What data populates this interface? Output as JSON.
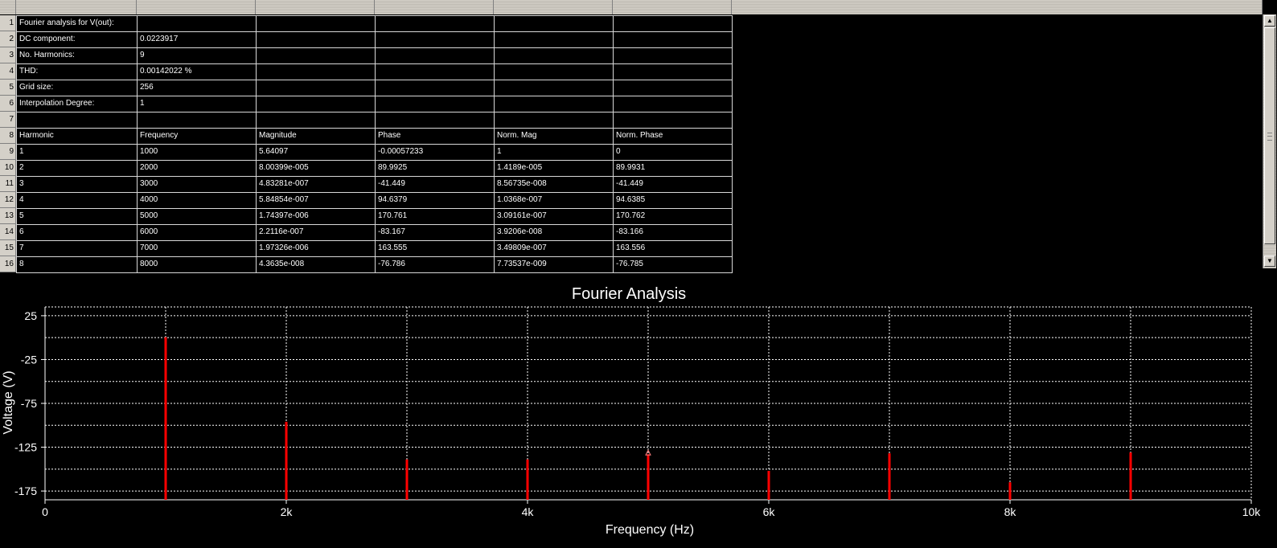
{
  "spreadsheet": {
    "column_headers": [
      "",
      "",
      "",
      "",
      "",
      ""
    ],
    "rows": [
      {
        "num": "1",
        "cells": [
          "Fourier analysis for V(out):",
          "",
          "",
          "",
          "",
          ""
        ]
      },
      {
        "num": "2",
        "cells": [
          "DC component:",
          "0.0223917",
          "",
          "",
          "",
          ""
        ]
      },
      {
        "num": "3",
        "cells": [
          "No. Harmonics:",
          "9",
          "",
          "",
          "",
          ""
        ]
      },
      {
        "num": "4",
        "cells": [
          "THD:",
          "0.00142022 %",
          "",
          "",
          "",
          ""
        ]
      },
      {
        "num": "5",
        "cells": [
          "Grid size:",
          "256",
          "",
          "",
          "",
          ""
        ]
      },
      {
        "num": "6",
        "cells": [
          "Interpolation Degree:",
          "1",
          "",
          "",
          "",
          ""
        ]
      },
      {
        "num": "7",
        "cells": [
          "",
          "",
          "",
          "",
          "",
          ""
        ]
      },
      {
        "num": "8",
        "cells": [
          "Harmonic",
          "Frequency",
          "Magnitude",
          "Phase",
          "Norm. Mag",
          "Norm. Phase"
        ]
      },
      {
        "num": "9",
        "cells": [
          "1",
          "1000",
          "5.64097",
          "-0.00057233",
          "1",
          "0"
        ]
      },
      {
        "num": "10",
        "cells": [
          "2",
          "2000",
          "8.00399e-005",
          "89.9925",
          "1.4189e-005",
          "89.9931"
        ]
      },
      {
        "num": "11",
        "cells": [
          "3",
          "3000",
          "4.83281e-007",
          "-41.449",
          "8.56735e-008",
          "-41.449"
        ]
      },
      {
        "num": "12",
        "cells": [
          "4",
          "4000",
          "5.84854e-007",
          "94.6379",
          "1.0368e-007",
          "94.6385"
        ]
      },
      {
        "num": "13",
        "cells": [
          "5",
          "5000",
          "1.74397e-006",
          "170.761",
          "3.09161e-007",
          "170.762"
        ]
      },
      {
        "num": "14",
        "cells": [
          "6",
          "6000",
          "2.2116e-007",
          "-83.167",
          "3.9206e-008",
          "-83.166"
        ]
      },
      {
        "num": "15",
        "cells": [
          "7",
          "7000",
          "1.97326e-006",
          "163.555",
          "3.49809e-007",
          "163.556"
        ]
      },
      {
        "num": "16",
        "cells": [
          "8",
          "8000",
          "4.3635e-008",
          "-76.786",
          "7.73537e-009",
          "-76.785"
        ]
      }
    ]
  },
  "chart_data": {
    "type": "bar",
    "title": "Fourier Analysis",
    "xlabel": "Frequency (Hz)",
    "ylabel": "Voltage (V)",
    "xlim": [
      0,
      10000
    ],
    "ylim": [
      -185,
      35
    ],
    "x_ticks": [
      0,
      2000,
      4000,
      6000,
      8000,
      10000
    ],
    "x_tick_labels": [
      "0",
      "2k",
      "4k",
      "6k",
      "8k",
      "10k"
    ],
    "y_ticks": [
      25,
      -25,
      -75,
      -125,
      -175
    ],
    "y_tick_labels": [
      "25",
      "-25",
      "-75",
      "-125",
      "-175"
    ],
    "y_gridlines": [
      25,
      0,
      -25,
      -50,
      -75,
      -100,
      -125,
      -150,
      -175
    ],
    "x_gridlines": [
      1000,
      2000,
      3000,
      4000,
      5000,
      6000,
      7000,
      8000,
      9000
    ],
    "grid": true,
    "bar_color": "#ff0000",
    "marker_color": "#ff8080",
    "marker_at": 5000,
    "series": [
      {
        "x": [
          1000,
          2000,
          3000,
          4000,
          5000,
          6000,
          7000,
          8000,
          9000
        ],
        "values": [
          0.5,
          -96,
          -139,
          -139,
          -133,
          -152,
          -132,
          -165,
          -131
        ]
      }
    ]
  }
}
